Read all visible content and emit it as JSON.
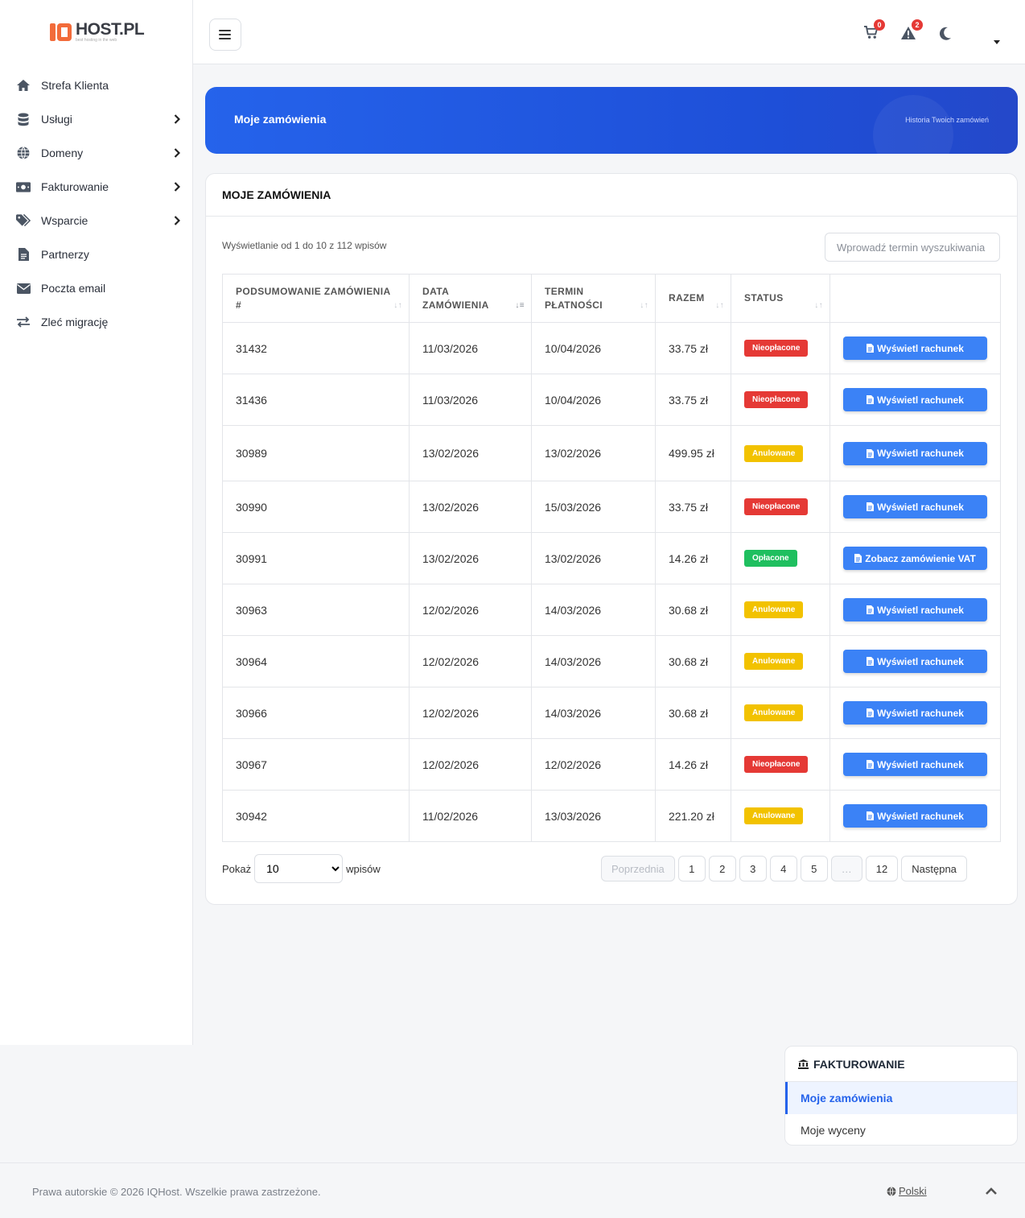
{
  "brand": {
    "name": "HOST.PL",
    "tagline": "best hosting in the web"
  },
  "sidebar": {
    "items": [
      {
        "label": "Strefa Klienta",
        "icon": "home-icon",
        "chevron": false
      },
      {
        "label": "Usługi",
        "icon": "database-icon",
        "chevron": true
      },
      {
        "label": "Domeny",
        "icon": "globe-icon",
        "chevron": true
      },
      {
        "label": "Fakturowanie",
        "icon": "money-icon",
        "chevron": true
      },
      {
        "label": "Wsparcie",
        "icon": "tags-icon",
        "chevron": true
      },
      {
        "label": "Partnerzy",
        "icon": "document-icon",
        "chevron": false
      },
      {
        "label": "Poczta email",
        "icon": "envelope-icon",
        "chevron": false
      },
      {
        "label": "Zleć migrację",
        "icon": "exchange-icon",
        "chevron": false
      }
    ]
  },
  "header": {
    "cart_count": "0",
    "alert_count": "2"
  },
  "banner": {
    "title": "Moje zamówienia",
    "subtitle": "Historia Twoich zamówień"
  },
  "card": {
    "title": "MOJE ZAMÓWIENIA",
    "info": "Wyświetlanie od 1 do 10 z 112 wpisów",
    "search_placeholder": "Wprowadź termin wyszukiwania"
  },
  "table": {
    "headers": {
      "summary": "PODSUMOWANIE ZAMÓWIENIA #",
      "date": "DATA ZAMÓWIENIA",
      "due": "TERMIN PŁATNOŚCI",
      "total": "RAZEM",
      "status": "STATUS"
    },
    "rows": [
      {
        "id": "31432",
        "date": "11/03/2026",
        "due": "10/04/2026",
        "total": "33.75 zł",
        "status": "Nieopłacone",
        "status_color": "red",
        "action": "Wyświetl rachunek"
      },
      {
        "id": "31436",
        "date": "11/03/2026",
        "due": "10/04/2026",
        "total": "33.75 zł",
        "status": "Nieopłacone",
        "status_color": "red",
        "action": "Wyświetl rachunek"
      },
      {
        "id": "30989",
        "date": "13/02/2026",
        "due": "13/02/2026",
        "total": "499.95 zł",
        "status": "Anulowane",
        "status_color": "yellow",
        "action": "Wyświetl rachunek"
      },
      {
        "id": "30990",
        "date": "13/02/2026",
        "due": "15/03/2026",
        "total": "33.75 zł",
        "status": "Nieopłacone",
        "status_color": "red",
        "action": "Wyświetl rachunek"
      },
      {
        "id": "30991",
        "date": "13/02/2026",
        "due": "13/02/2026",
        "total": "14.26 zł",
        "status": "Opłacone",
        "status_color": "green",
        "action": "Zobacz zamówienie VAT"
      },
      {
        "id": "30963",
        "date": "12/02/2026",
        "due": "14/03/2026",
        "total": "30.68 zł",
        "status": "Anulowane",
        "status_color": "yellow",
        "action": "Wyświetl rachunek"
      },
      {
        "id": "30964",
        "date": "12/02/2026",
        "due": "14/03/2026",
        "total": "30.68 zł",
        "status": "Anulowane",
        "status_color": "yellow",
        "action": "Wyświetl rachunek"
      },
      {
        "id": "30966",
        "date": "12/02/2026",
        "due": "14/03/2026",
        "total": "30.68 zł",
        "status": "Anulowane",
        "status_color": "yellow",
        "action": "Wyświetl rachunek"
      },
      {
        "id": "30967",
        "date": "12/02/2026",
        "due": "12/02/2026",
        "total": "14.26 zł",
        "status": "Nieopłacone",
        "status_color": "red",
        "action": "Wyświetl rachunek"
      },
      {
        "id": "30942",
        "date": "11/02/2026",
        "due": "13/03/2026",
        "total": "221.20 zł",
        "status": "Anulowane",
        "status_color": "yellow",
        "action": "Wyświetl rachunek"
      }
    ]
  },
  "pagination": {
    "show_label": "Pokaż",
    "per_page": "10",
    "entries_label": "wpisów",
    "prev": "Poprzednia",
    "pages": [
      "1",
      "2",
      "3",
      "4",
      "5",
      "…",
      "12"
    ],
    "next": "Następna"
  },
  "subnav": {
    "title": "FAKTUROWANIE",
    "items": [
      {
        "label": "Moje zamówienia",
        "active": true
      },
      {
        "label": "Moje wyceny",
        "active": false
      }
    ]
  },
  "footer": {
    "copyright": "Prawa autorskie © 2026 IQHost. Wszelkie prawa zastrzeżone.",
    "language": "Polski"
  },
  "colors": {
    "primary": "#2563eb",
    "button": "#3b82f6",
    "danger": "#e53935",
    "warning": "#f2c200",
    "success": "#1fbf5f"
  }
}
